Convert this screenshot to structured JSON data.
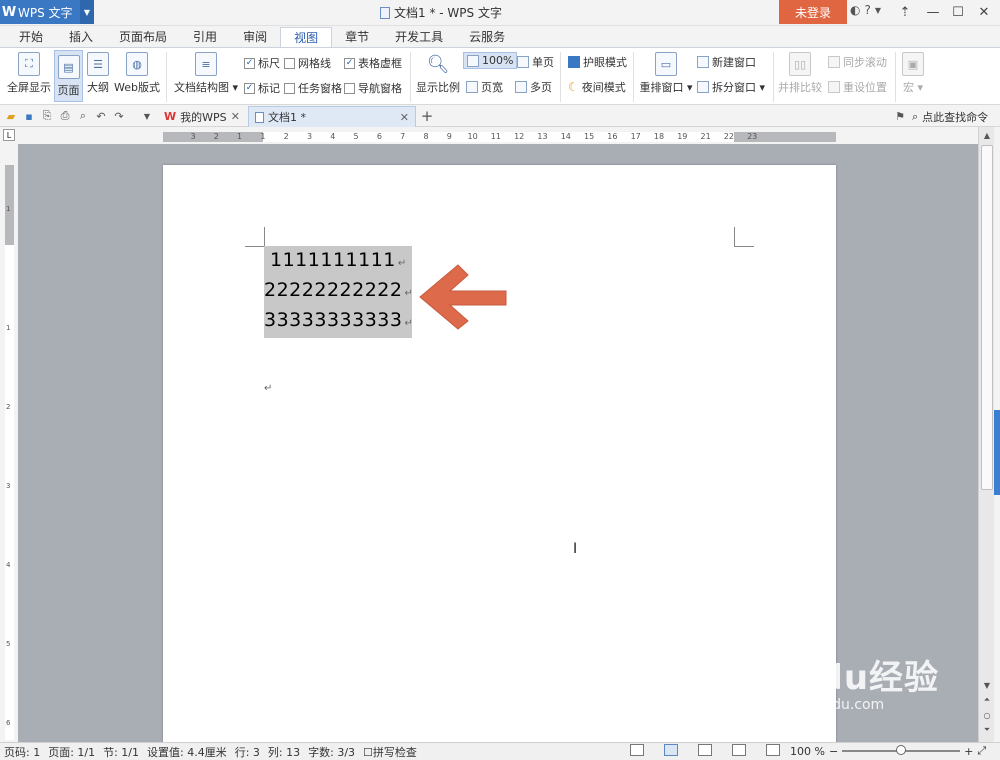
{
  "app": {
    "logo_text": "W",
    "app_button_label": "WPS 文字",
    "window_title": "文档1 * - WPS 文字",
    "login_label": "未登录",
    "minimize": "—",
    "maximize": "☐",
    "close": "✕"
  },
  "menu": {
    "tabs": [
      {
        "label": "开始"
      },
      {
        "label": "插入"
      },
      {
        "label": "页面布局"
      },
      {
        "label": "引用"
      },
      {
        "label": "审阅"
      },
      {
        "label": "视图"
      },
      {
        "label": "章节"
      },
      {
        "label": "开发工具"
      },
      {
        "label": "云服务"
      }
    ],
    "active_index": 5
  },
  "ribbon": {
    "fullscreen": "全屏显示",
    "page_view": "页面",
    "outline": "大纲",
    "web_layout": "Web版式",
    "doc_map": "文档结构图",
    "ruler": "标尺",
    "gridlines": "网格线",
    "table_gridlines": "表格虚框",
    "marks": "标记",
    "task_pane": "任务窗格",
    "nav_pane": "导航窗格",
    "zoom": "显示比例",
    "zoom100": "100%",
    "page_width": "页宽",
    "one_page": "单页",
    "multi_page": "多页",
    "eye_protect": "护眼模式",
    "night_mode": "夜间模式",
    "arrange_window": "重排窗口",
    "new_window": "新建窗口",
    "split_window": "拆分窗口",
    "side_by_side": "并排比较",
    "sync_scroll": "同步滚动",
    "reset_position": "重设位置",
    "macro": "宏"
  },
  "doc_tabs": {
    "my_wps": "我的WPS",
    "doc1": "文档1 *",
    "find_cmd": "点此查找命令"
  },
  "ruler": {
    "numbers": [
      "3",
      "2",
      "1",
      "1",
      "2",
      "3",
      "4",
      "5",
      "6",
      "7",
      "8",
      "9",
      "10",
      "11",
      "12",
      "13",
      "14",
      "15",
      "16",
      "17",
      "18",
      "19",
      "21",
      "22",
      "23"
    ],
    "v_numbers": [
      "1",
      "1",
      "2",
      "3",
      "4",
      "5",
      "6"
    ]
  },
  "document": {
    "line1": "1111111111",
    "line2": "22222222222",
    "line3": "33333333333",
    "para_mark": "↵"
  },
  "status": {
    "page_code": "页码: 1",
    "pages": "页面: 1/1",
    "section": "节: 1/1",
    "setting": "设置值: 4.4厘米",
    "row": "行: 3",
    "col": "列: 13",
    "word_count": "字数: 3/3",
    "spell_check": "拼写检查",
    "zoom": "100 %"
  },
  "watermark": {
    "brand": "Baidu经验",
    "url": "jingyan.baidu.com"
  },
  "colors": {
    "accent": "#3b78c4",
    "login": "#e06642",
    "arrow": "#dd6a4b"
  }
}
